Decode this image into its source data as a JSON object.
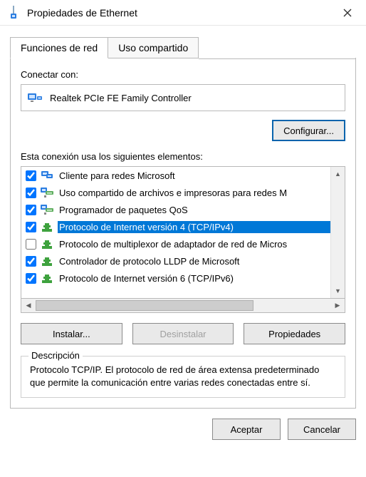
{
  "window": {
    "title": "Propiedades de Ethernet"
  },
  "tabs": {
    "networking": "Funciones de red",
    "sharing": "Uso compartido"
  },
  "connect_label": "Conectar con:",
  "adapter_name": "Realtek PCIe FE Family Controller",
  "configure_btn": "Configurar...",
  "items_label": "Esta conexión usa los siguientes elementos:",
  "items": [
    {
      "checked": true,
      "icon": "client",
      "label": "Cliente para redes Microsoft",
      "selected": false
    },
    {
      "checked": true,
      "icon": "service",
      "label": "Uso compartido de archivos e impresoras para redes M",
      "selected": false
    },
    {
      "checked": true,
      "icon": "service",
      "label": "Programador de paquetes QoS",
      "selected": false
    },
    {
      "checked": true,
      "icon": "protocol",
      "label": "Protocolo de Internet versión 4 (TCP/IPv4)",
      "selected": true
    },
    {
      "checked": false,
      "icon": "protocol",
      "label": "Protocolo de multiplexor de adaptador de red de Micros",
      "selected": false
    },
    {
      "checked": true,
      "icon": "protocol",
      "label": "Controlador de protocolo LLDP de Microsoft",
      "selected": false
    },
    {
      "checked": true,
      "icon": "protocol",
      "label": "Protocolo de Internet versión 6 (TCP/IPv6)",
      "selected": false
    }
  ],
  "install_btn": "Instalar...",
  "uninstall_btn": "Desinstalar",
  "properties_btn": "Propiedades",
  "description": {
    "legend": "Descripción",
    "text": "Protocolo TCP/IP. El protocolo de red de área extensa predeterminado que permite la comunicación entre varias redes conectadas entre sí."
  },
  "ok_btn": "Aceptar",
  "cancel_btn": "Cancelar"
}
